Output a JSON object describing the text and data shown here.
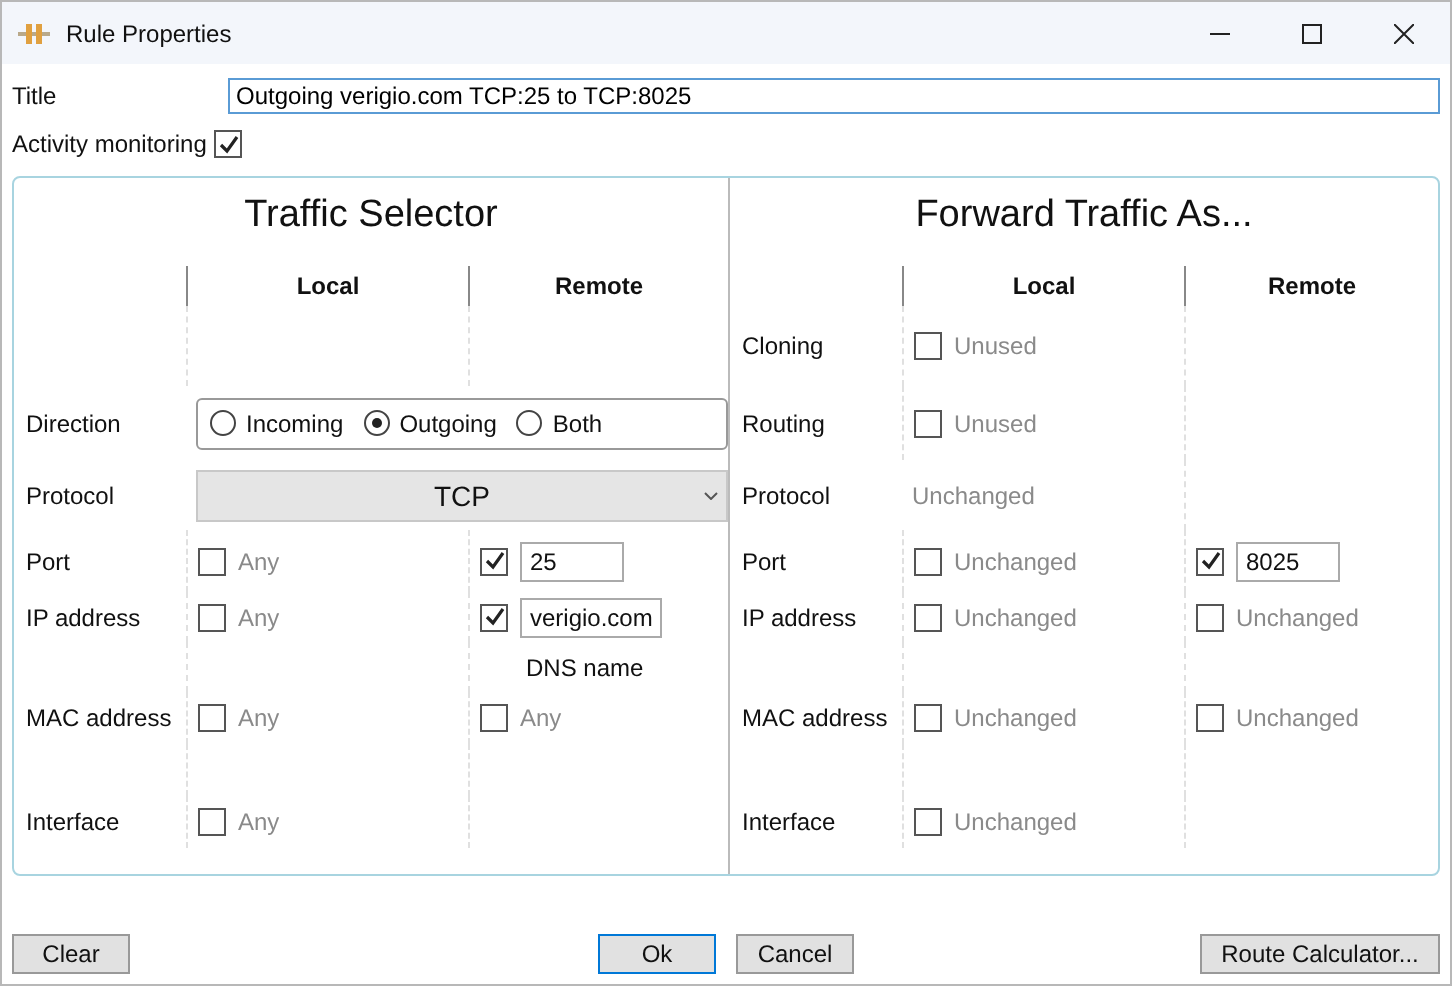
{
  "window": {
    "title": "Rule Properties"
  },
  "title_field": {
    "label": "Title",
    "value": "Outgoing verigio.com TCP:25 to TCP:8025"
  },
  "activity_monitoring": {
    "label": "Activity monitoring",
    "checked": true
  },
  "panels": [
    {
      "heading": "Traffic Selector",
      "columns": [
        "Local",
        "Remote"
      ],
      "rows": [
        {
          "kind": "spacer"
        },
        {
          "kind": "radios",
          "label": "Direction",
          "options": [
            {
              "label": "Incoming",
              "selected": false
            },
            {
              "label": "Outgoing",
              "selected": true
            },
            {
              "label": "Both",
              "selected": false
            }
          ]
        },
        {
          "kind": "select",
          "label": "Protocol",
          "value": "TCP"
        },
        {
          "kind": "cells",
          "label": "Port",
          "cells": [
            {
              "checked": false,
              "text": "Any"
            },
            {
              "checked": true,
              "value": "25"
            }
          ]
        },
        {
          "kind": "cells",
          "label": "IP address",
          "cells": [
            {
              "checked": false,
              "text": "Any"
            },
            {
              "checked": true,
              "value": "verigio.com"
            }
          ]
        },
        {
          "kind": "note",
          "text": "DNS name"
        },
        {
          "kind": "cells",
          "label": "MAC address",
          "cells": [
            {
              "checked": false,
              "text": "Any"
            },
            {
              "checked": false,
              "text": "Any"
            }
          ]
        },
        {
          "kind": "spacer"
        },
        {
          "kind": "cells",
          "label": "Interface",
          "cells": [
            {
              "checked": false,
              "text": "Any"
            }
          ]
        }
      ]
    },
    {
      "heading": "Forward Traffic As...",
      "columns": [
        "Local",
        "Remote"
      ],
      "rows": [
        {
          "kind": "cells",
          "label": "Cloning",
          "cells": [
            {
              "checked": false,
              "text": "Unused"
            }
          ]
        },
        {
          "kind": "cells",
          "label": "Routing",
          "cells": [
            {
              "checked": false,
              "text": "Unused"
            }
          ]
        },
        {
          "kind": "plain",
          "label": "Protocol",
          "text": "Unchanged"
        },
        {
          "kind": "cells",
          "label": "Port",
          "cells": [
            {
              "checked": false,
              "text": "Unchanged"
            },
            {
              "checked": true,
              "value": "8025"
            }
          ]
        },
        {
          "kind": "cells",
          "label": "IP address",
          "cells": [
            {
              "checked": false,
              "text": "Unchanged"
            },
            {
              "checked": false,
              "text": "Unchanged"
            }
          ]
        },
        {
          "kind": "spacer"
        },
        {
          "kind": "cells",
          "label": "MAC address",
          "cells": [
            {
              "checked": false,
              "text": "Unchanged"
            },
            {
              "checked": false,
              "text": "Unchanged"
            }
          ]
        },
        {
          "kind": "spacer"
        },
        {
          "kind": "cells",
          "label": "Interface",
          "cells": [
            {
              "checked": false,
              "text": "Unchanged"
            }
          ]
        }
      ]
    }
  ],
  "buttons": [
    {
      "label": "Clear",
      "kind": "left",
      "default": false
    },
    {
      "label": "Ok",
      "kind": "center",
      "default": true
    },
    {
      "label": "Cancel",
      "kind": "center",
      "default": false
    },
    {
      "label": "Route Calculator...",
      "kind": "right",
      "default": false
    }
  ]
}
